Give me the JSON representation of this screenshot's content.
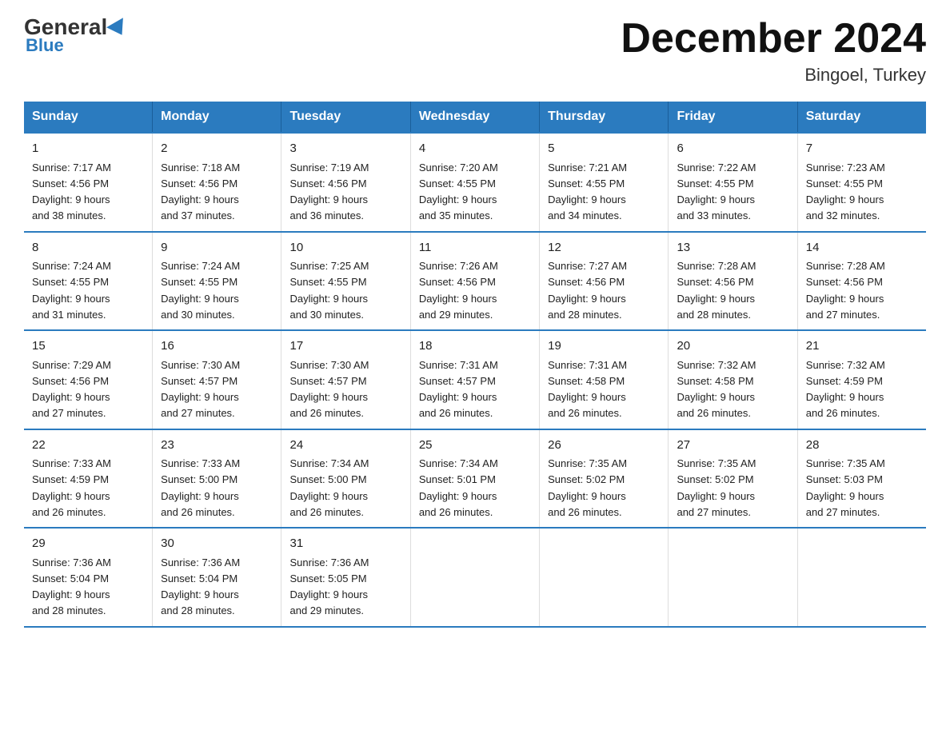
{
  "logo": {
    "general": "General",
    "blue": "Blue"
  },
  "title": "December 2024",
  "subtitle": "Bingoel, Turkey",
  "days_of_week": [
    "Sunday",
    "Monday",
    "Tuesday",
    "Wednesday",
    "Thursday",
    "Friday",
    "Saturday"
  ],
  "weeks": [
    [
      {
        "day": "1",
        "sunrise": "7:17 AM",
        "sunset": "4:56 PM",
        "daylight": "9 hours and 38 minutes."
      },
      {
        "day": "2",
        "sunrise": "7:18 AM",
        "sunset": "4:56 PM",
        "daylight": "9 hours and 37 minutes."
      },
      {
        "day": "3",
        "sunrise": "7:19 AM",
        "sunset": "4:56 PM",
        "daylight": "9 hours and 36 minutes."
      },
      {
        "day": "4",
        "sunrise": "7:20 AM",
        "sunset": "4:55 PM",
        "daylight": "9 hours and 35 minutes."
      },
      {
        "day": "5",
        "sunrise": "7:21 AM",
        "sunset": "4:55 PM",
        "daylight": "9 hours and 34 minutes."
      },
      {
        "day": "6",
        "sunrise": "7:22 AM",
        "sunset": "4:55 PM",
        "daylight": "9 hours and 33 minutes."
      },
      {
        "day": "7",
        "sunrise": "7:23 AM",
        "sunset": "4:55 PM",
        "daylight": "9 hours and 32 minutes."
      }
    ],
    [
      {
        "day": "8",
        "sunrise": "7:24 AM",
        "sunset": "4:55 PM",
        "daylight": "9 hours and 31 minutes."
      },
      {
        "day": "9",
        "sunrise": "7:24 AM",
        "sunset": "4:55 PM",
        "daylight": "9 hours and 30 minutes."
      },
      {
        "day": "10",
        "sunrise": "7:25 AM",
        "sunset": "4:55 PM",
        "daylight": "9 hours and 30 minutes."
      },
      {
        "day": "11",
        "sunrise": "7:26 AM",
        "sunset": "4:56 PM",
        "daylight": "9 hours and 29 minutes."
      },
      {
        "day": "12",
        "sunrise": "7:27 AM",
        "sunset": "4:56 PM",
        "daylight": "9 hours and 28 minutes."
      },
      {
        "day": "13",
        "sunrise": "7:28 AM",
        "sunset": "4:56 PM",
        "daylight": "9 hours and 28 minutes."
      },
      {
        "day": "14",
        "sunrise": "7:28 AM",
        "sunset": "4:56 PM",
        "daylight": "9 hours and 27 minutes."
      }
    ],
    [
      {
        "day": "15",
        "sunrise": "7:29 AM",
        "sunset": "4:56 PM",
        "daylight": "9 hours and 27 minutes."
      },
      {
        "day": "16",
        "sunrise": "7:30 AM",
        "sunset": "4:57 PM",
        "daylight": "9 hours and 27 minutes."
      },
      {
        "day": "17",
        "sunrise": "7:30 AM",
        "sunset": "4:57 PM",
        "daylight": "9 hours and 26 minutes."
      },
      {
        "day": "18",
        "sunrise": "7:31 AM",
        "sunset": "4:57 PM",
        "daylight": "9 hours and 26 minutes."
      },
      {
        "day": "19",
        "sunrise": "7:31 AM",
        "sunset": "4:58 PM",
        "daylight": "9 hours and 26 minutes."
      },
      {
        "day": "20",
        "sunrise": "7:32 AM",
        "sunset": "4:58 PM",
        "daylight": "9 hours and 26 minutes."
      },
      {
        "day": "21",
        "sunrise": "7:32 AM",
        "sunset": "4:59 PM",
        "daylight": "9 hours and 26 minutes."
      }
    ],
    [
      {
        "day": "22",
        "sunrise": "7:33 AM",
        "sunset": "4:59 PM",
        "daylight": "9 hours and 26 minutes."
      },
      {
        "day": "23",
        "sunrise": "7:33 AM",
        "sunset": "5:00 PM",
        "daylight": "9 hours and 26 minutes."
      },
      {
        "day": "24",
        "sunrise": "7:34 AM",
        "sunset": "5:00 PM",
        "daylight": "9 hours and 26 minutes."
      },
      {
        "day": "25",
        "sunrise": "7:34 AM",
        "sunset": "5:01 PM",
        "daylight": "9 hours and 26 minutes."
      },
      {
        "day": "26",
        "sunrise": "7:35 AM",
        "sunset": "5:02 PM",
        "daylight": "9 hours and 26 minutes."
      },
      {
        "day": "27",
        "sunrise": "7:35 AM",
        "sunset": "5:02 PM",
        "daylight": "9 hours and 27 minutes."
      },
      {
        "day": "28",
        "sunrise": "7:35 AM",
        "sunset": "5:03 PM",
        "daylight": "9 hours and 27 minutes."
      }
    ],
    [
      {
        "day": "29",
        "sunrise": "7:36 AM",
        "sunset": "5:04 PM",
        "daylight": "9 hours and 28 minutes."
      },
      {
        "day": "30",
        "sunrise": "7:36 AM",
        "sunset": "5:04 PM",
        "daylight": "9 hours and 28 minutes."
      },
      {
        "day": "31",
        "sunrise": "7:36 AM",
        "sunset": "5:05 PM",
        "daylight": "9 hours and 29 minutes."
      },
      null,
      null,
      null,
      null
    ]
  ],
  "labels": {
    "sunrise": "Sunrise:",
    "sunset": "Sunset:",
    "daylight": "Daylight:"
  }
}
